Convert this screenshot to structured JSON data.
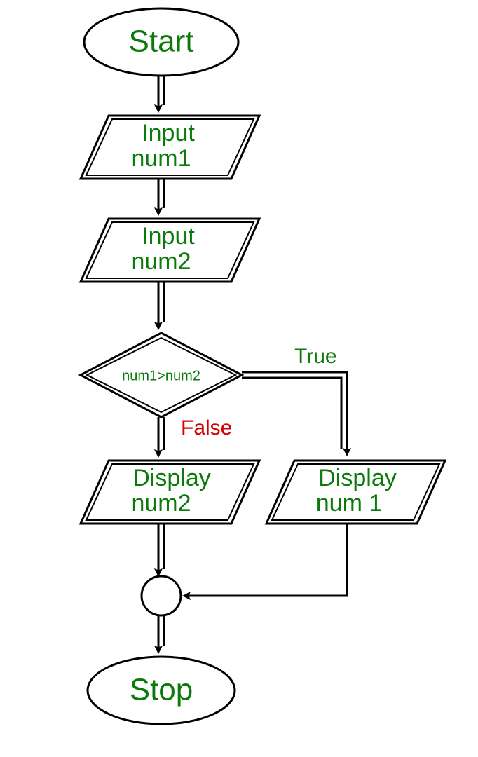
{
  "flowchart": {
    "start": "Start",
    "stop": "Stop",
    "input1_line1": "Input",
    "input1_line2": "num1",
    "input2_line1": "Input",
    "input2_line2": "num2",
    "condition": "num1>num2",
    "branch_true": "True",
    "branch_false": "False",
    "display_false_line1": "Display",
    "display_false_line2": "num2",
    "display_true_line1": "Display",
    "display_true_line2": "num 1"
  }
}
